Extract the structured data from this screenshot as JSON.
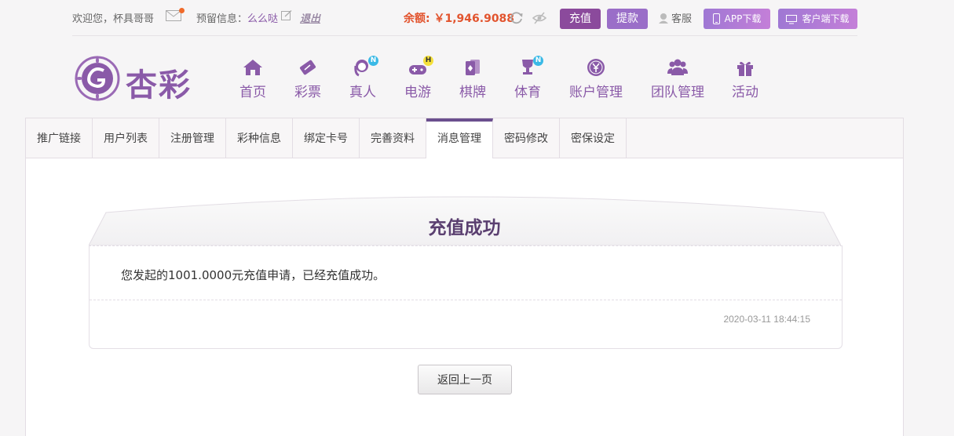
{
  "topbar": {
    "welcome": "欢迎您，杯具哥哥",
    "reserve_label": "预留信息：",
    "reserve_value": "么么哒",
    "logout": "退出",
    "balance": "余额: ￥1,946.9088",
    "recharge": "充值",
    "withdraw": "提款",
    "service": "客服",
    "app_download": "APP下载",
    "client_download": "客户端下载"
  },
  "logo": {
    "text": "杏彩"
  },
  "nav": {
    "items": [
      {
        "label": "首页",
        "icon": "home-icon"
      },
      {
        "label": "彩票",
        "icon": "ticket-icon"
      },
      {
        "label": "真人",
        "icon": "live-dealer-icon",
        "badge": "N"
      },
      {
        "label": "电游",
        "icon": "gamepad-icon",
        "badge": "H"
      },
      {
        "label": "棋牌",
        "icon": "cards-icon"
      },
      {
        "label": "体育",
        "icon": "trophy-icon",
        "badge": "N"
      },
      {
        "label": "账户管理",
        "icon": "yuan-coin-icon"
      },
      {
        "label": "团队管理",
        "icon": "team-icon"
      },
      {
        "label": "活动",
        "icon": "gift-icon"
      }
    ]
  },
  "tabs": [
    "推广链接",
    "用户列表",
    "注册管理",
    "彩种信息",
    "绑定卡号",
    "完善资料",
    "消息管理",
    "密码修改",
    "密保设定"
  ],
  "active_tab": "消息管理",
  "message": {
    "title": "充值成功",
    "body": "您发起的1001.0000元充值申请，已经充值成功。",
    "time": "2020-03-11 18:44:15"
  },
  "back_button": "返回上一页",
  "colors": {
    "brand": "#8a5aa8",
    "balance": "#e2542e",
    "recharge": "#8b4a9c",
    "withdraw": "#9a6ec8",
    "active_tab": "#6b4f8e"
  }
}
